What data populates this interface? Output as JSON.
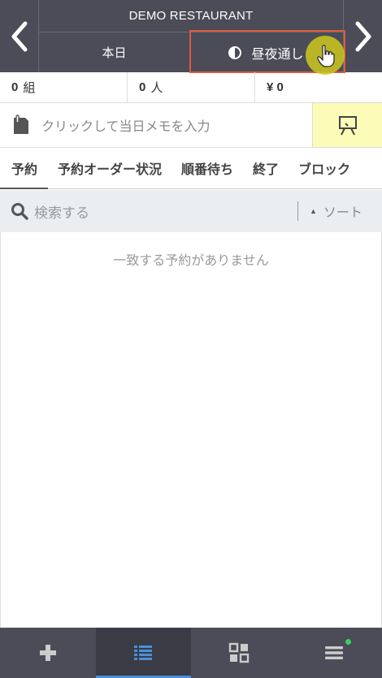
{
  "header": {
    "title": "DEMO RESTAURANT",
    "date_label": "本日",
    "shift_label": "昼夜通し"
  },
  "stats": {
    "groups_value": "0",
    "groups_unit": "組",
    "people_value": "0",
    "people_unit": "人",
    "sales_label": "¥ 0"
  },
  "memo": {
    "placeholder": "クリックして当日メモを入力"
  },
  "tabs": [
    {
      "label": "予約",
      "active": true
    },
    {
      "label": "予約オーダー状況",
      "active": false
    },
    {
      "label": "順番待ち",
      "active": false
    },
    {
      "label": "終了",
      "active": false
    },
    {
      "label": "ブロック",
      "active": false
    }
  ],
  "search": {
    "placeholder": "検索する",
    "sort_label": "ソート"
  },
  "list": {
    "empty_message": "一致する予約がありません"
  },
  "bottom_nav": [
    {
      "icon": "plus-icon",
      "active": false
    },
    {
      "icon": "list-icon",
      "active": true
    },
    {
      "icon": "grid-icon",
      "active": false
    },
    {
      "icon": "menu-icon",
      "active": false,
      "badge": true
    }
  ],
  "colors": {
    "header_bg": "#4b4c57",
    "accent_blue": "#4a90d9",
    "highlight_yellow": "#fcfcb8",
    "annotation_red": "#e0593a",
    "notification_green": "#3ecf5c"
  }
}
